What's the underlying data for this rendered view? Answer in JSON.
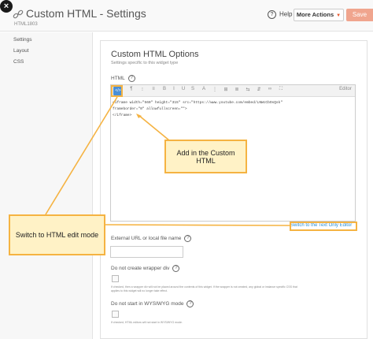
{
  "header": {
    "title": "Custom HTML - Settings",
    "widget_id": "HTML1803",
    "help_label": "Help",
    "help_glyph": "?",
    "more_actions_label": "More Actions",
    "more_actions_caret": "▼",
    "save_label": "Save",
    "close_glyph": "×"
  },
  "sidebar": {
    "items": [
      {
        "label": "Settings"
      },
      {
        "label": "Layout"
      },
      {
        "label": "CSS"
      }
    ]
  },
  "section": {
    "title": "Custom HTML Options",
    "subtitle": "Settings specific to this widget type"
  },
  "html_field": {
    "label": "HTML",
    "help_glyph": "?",
    "toolbar": {
      "html_button": "</>",
      "buttons": [
        "¶",
        "⁝",
        "≡",
        "B",
        "I",
        "U",
        "S",
        "A",
        "⋮",
        "⊞",
        "≣",
        "⇆",
        "⇵",
        "∞",
        "⛶"
      ],
      "more": "Editor"
    },
    "code_lines": [
      "<iframe width=\"560\" height=\"315\" src=\"https://www.youtube.com/embed/LNWcCbOsQsk\"",
      "frameborder=\"0\" allowfullscreen=\"\">",
      "</iframe>"
    ],
    "switch_link": "Switch to the Text Only Editor"
  },
  "external_url": {
    "label": "External URL or local file name",
    "help_glyph": "?",
    "value": ""
  },
  "wrapper_div": {
    "label": "Do not create wrapper div",
    "help_glyph": "?",
    "checked": false,
    "help_line1": "If checked, then a wrapper div will not be placed around the contents of this widget. If the wrapper is not created, any global or instance specific CSS that",
    "help_line2": "applies to this widget will no longer take effect."
  },
  "wysiwyg": {
    "label": "Do not start in WYSIWYG mode",
    "help_glyph": "?",
    "checked": false,
    "help_line1": "If checked, HTML editors will not start in WYSIWYG mode."
  },
  "callouts": {
    "custom_html": "Add in the Custom HTML",
    "html_mode": "Switch to HTML edit mode"
  },
  "colors": {
    "accent": "#e8552b",
    "callout_border": "#f5b342",
    "callout_fill": "#fff2c6",
    "link": "#2a8fd6"
  }
}
